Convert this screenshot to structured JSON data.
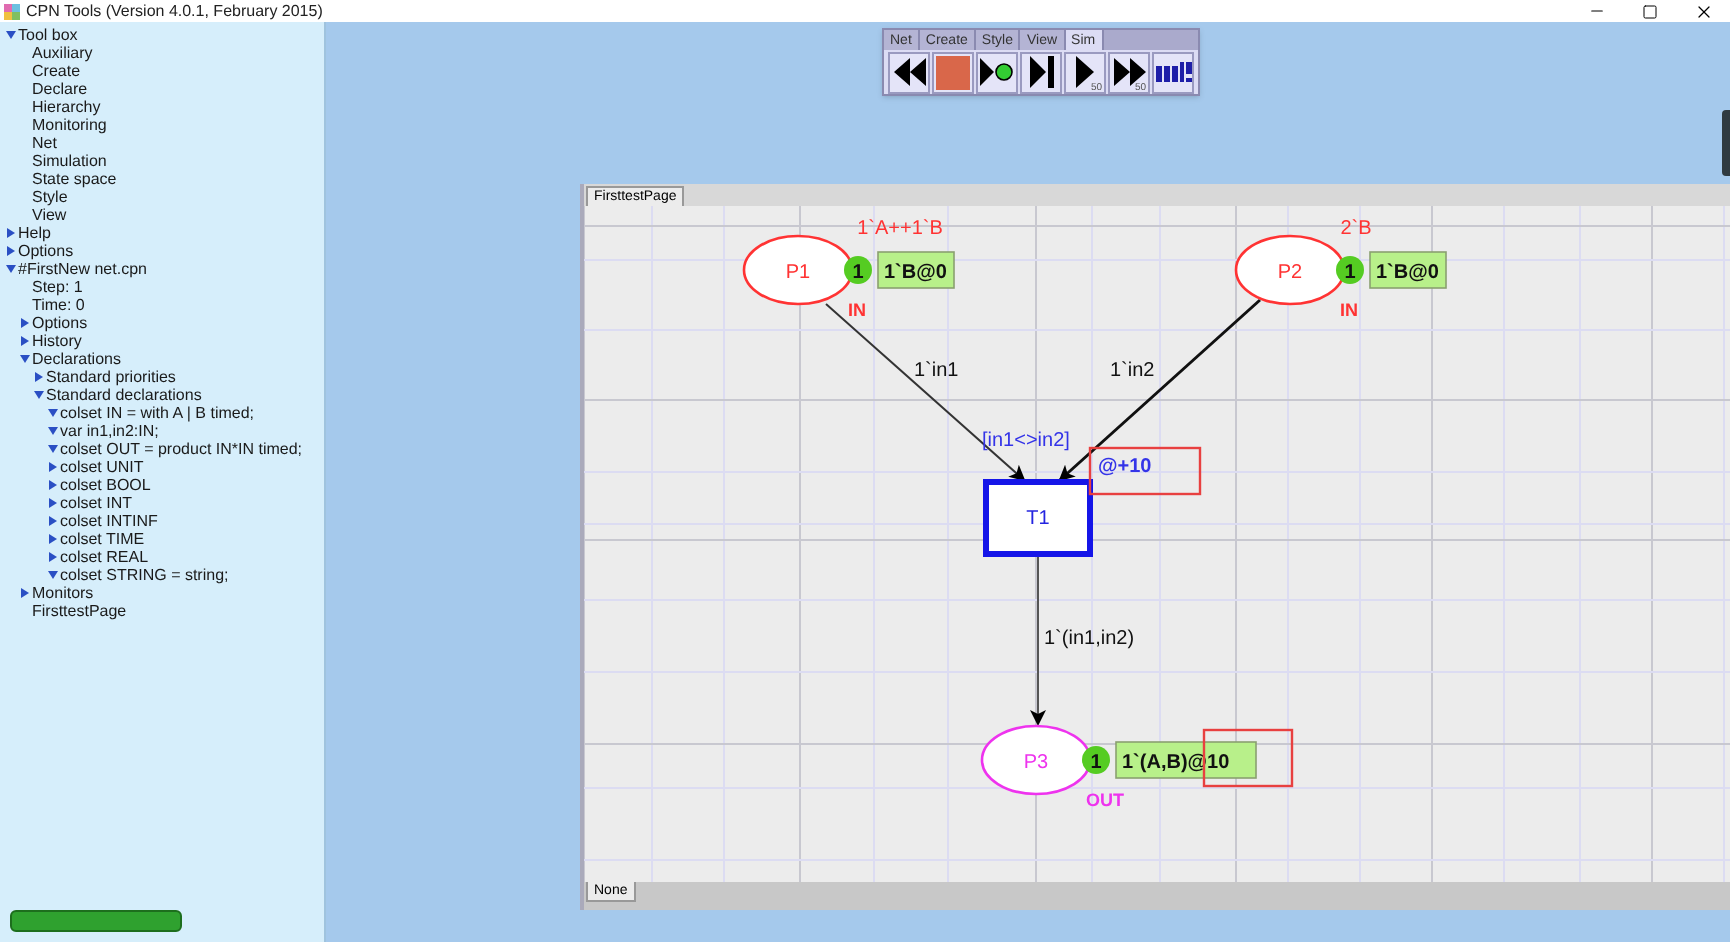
{
  "window": {
    "title": "CPN Tools (Version 4.0.1, February 2015)"
  },
  "tree": [
    {
      "label": "Tool box",
      "expanded": true,
      "children": [
        {
          "label": "Auxiliary"
        },
        {
          "label": "Create"
        },
        {
          "label": "Declare"
        },
        {
          "label": "Hierarchy"
        },
        {
          "label": "Monitoring"
        },
        {
          "label": "Net"
        },
        {
          "label": "Simulation"
        },
        {
          "label": "State space"
        },
        {
          "label": "Style"
        },
        {
          "label": "View"
        }
      ]
    },
    {
      "label": "Help",
      "expanded": false
    },
    {
      "label": "Options",
      "expanded": false
    },
    {
      "label": "#FirstNew net.cpn",
      "expanded": true,
      "children": [
        {
          "label": "Step: 1"
        },
        {
          "label": "Time: 0"
        },
        {
          "label": "Options",
          "expanded": false
        },
        {
          "label": "History",
          "expanded": false
        },
        {
          "label": "Declarations",
          "expanded": true,
          "children": [
            {
              "label": "Standard priorities",
              "expanded": false
            },
            {
              "label": "Standard declarations",
              "expanded": true,
              "children": [
                {
                  "label": "colset IN = with A | B timed;",
                  "expanded": true
                },
                {
                  "label": "var in1,in2:IN;",
                  "expanded": true
                },
                {
                  "label": "colset OUT = product IN*IN timed;",
                  "expanded": true
                },
                {
                  "label": "colset UNIT",
                  "expanded": false
                },
                {
                  "label": "colset BOOL",
                  "expanded": false
                },
                {
                  "label": "colset INT",
                  "expanded": false
                },
                {
                  "label": "colset INTINF",
                  "expanded": false
                },
                {
                  "label": "colset TIME",
                  "expanded": false
                },
                {
                  "label": "colset REAL",
                  "expanded": false
                },
                {
                  "label": "colset STRING = string;",
                  "expanded": true
                }
              ]
            }
          ]
        },
        {
          "label": "Monitors",
          "expanded": false
        },
        {
          "label": "FirsttestPage"
        }
      ]
    }
  ],
  "palette": {
    "tabs": [
      {
        "label": "Net",
        "selected": false
      },
      {
        "label": "Create",
        "selected": false
      },
      {
        "label": "Style",
        "selected": false
      },
      {
        "label": "View",
        "selected": false
      },
      {
        "label": "Sim",
        "selected": true
      }
    ],
    "tools": [
      {
        "kind": "rewind"
      },
      {
        "kind": "stop"
      },
      {
        "kind": "play"
      },
      {
        "kind": "step"
      },
      {
        "kind": "play-n",
        "label": "50"
      },
      {
        "kind": "fast-forward",
        "label": "50"
      },
      {
        "kind": "ml"
      }
    ]
  },
  "page": {
    "tab": "FirsttestPage",
    "status": "None",
    "places": [
      {
        "name": "P1",
        "color": "#ff3333",
        "initial_marking": "1`A++1`B",
        "tokens": "1",
        "marking": "1`B@0",
        "port": "IN"
      },
      {
        "name": "P2",
        "color": "#ff3333",
        "initial_marking": "2`B",
        "tokens": "1",
        "marking": "1`B@0",
        "port": "IN"
      },
      {
        "name": "P3",
        "color": "#ee33ee",
        "tokens": "1",
        "marking": "1`(A,B)@10",
        "port": "OUT"
      }
    ],
    "transitions": [
      {
        "name": "T1",
        "guard": "[in1<>in2]",
        "time": "@+10"
      }
    ],
    "arcs": [
      {
        "inscription": "1`in1"
      },
      {
        "inscription": "1`in2"
      },
      {
        "inscription": "1`(in1,in2)"
      }
    ]
  }
}
